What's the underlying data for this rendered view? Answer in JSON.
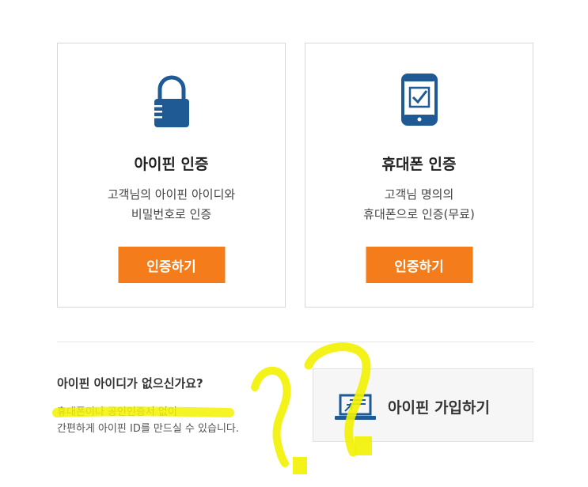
{
  "cards": [
    {
      "icon": "padlock-icon",
      "title": "아이핀 인증",
      "desc": [
        "고객님의 아이핀 아이디와",
        "비밀번호로 인증"
      ],
      "button": "인증하기"
    },
    {
      "icon": "smartphone-check-icon",
      "title": "휴대폰 인증",
      "desc": [
        "고객님 명의의",
        "휴대폰으로 인증(무료)"
      ],
      "button": "인증하기"
    }
  ],
  "signup": {
    "question": "아이핀 아이디가 없으신가요?",
    "desc": [
      "휴대폰이나 공인인증서 없이",
      "간편하게 아이핀 ID를 만드실 수 있습니다."
    ],
    "button_icon": "laptop-icon",
    "button": "아이핀 가입하기"
  },
  "colors": {
    "accent_orange": "#f47c1a",
    "icon_blue": "#1f5a94",
    "highlighter_yellow": "#f2f200"
  }
}
